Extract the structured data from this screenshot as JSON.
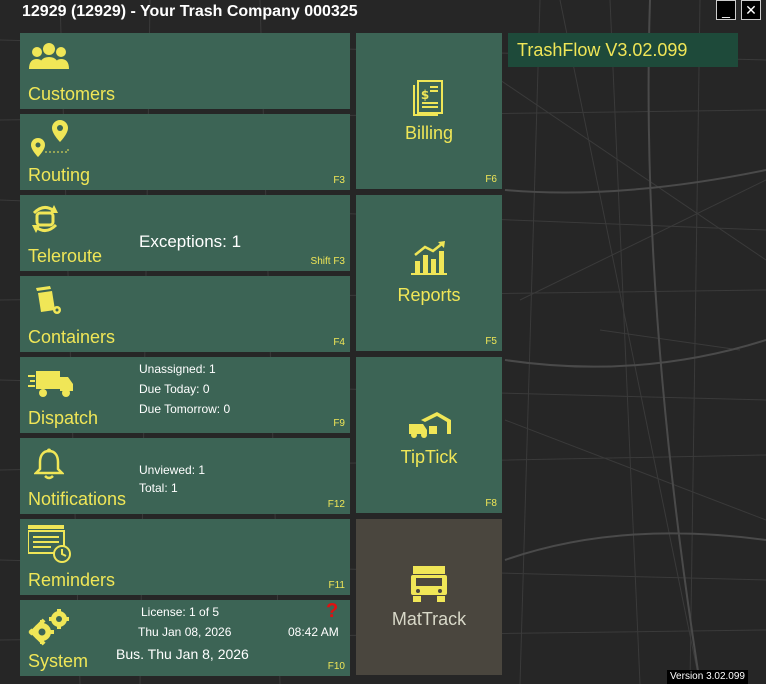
{
  "window": {
    "title": "12929 (12929) - Your Trash Company 000325",
    "minimize": "_",
    "close": "✕"
  },
  "app_version": "TrashFlow  V3.02.099",
  "footer_version": "Version 3.02.099",
  "colors": {
    "tile": "#3c6455",
    "tile_dark": "#4a463e",
    "accent": "#f0e657",
    "version_box": "#1e4a3a"
  },
  "tiles": {
    "customers": {
      "label": "Customers",
      "icon": "people-icon"
    },
    "routing": {
      "label": "Routing",
      "fkey": "F3",
      "icon": "map-pin-icon"
    },
    "teleroute": {
      "label": "Teleroute",
      "fkey": "Shift F3",
      "exceptions": "Exceptions: 1",
      "icon": "teleroute-icon"
    },
    "containers": {
      "label": "Containers",
      "fkey": "F4",
      "icon": "trash-can-icon"
    },
    "dispatch": {
      "label": "Dispatch",
      "fkey": "F9",
      "unassigned": "Unassigned: 1",
      "due_today": "Due Today: 0",
      "due_tomorrow": "Due Tomorrow: 0",
      "icon": "truck-icon"
    },
    "notifications": {
      "label": "Notifications",
      "fkey": "F12",
      "unviewed": "Unviewed: 1",
      "total": "Total: 1",
      "icon": "bell-icon"
    },
    "reminders": {
      "label": "Reminders",
      "fkey": "F11",
      "icon": "calendar-clock-icon"
    },
    "system": {
      "label": "System",
      "fkey": "F10",
      "license": "License: 1 of 5",
      "date": "Thu Jan 08, 2026",
      "time": "08:42 AM",
      "bus_date": "Bus. Thu Jan 8, 2026",
      "help": "?",
      "icon": "gears-icon"
    },
    "billing": {
      "label": "Billing",
      "fkey": "F6",
      "icon": "invoice-icon"
    },
    "reports": {
      "label": "Reports",
      "fkey": "F5",
      "icon": "bar-chart-icon"
    },
    "tiptick": {
      "label": "TipTick",
      "fkey": "F8",
      "icon": "dump-truck-icon"
    },
    "mattrack": {
      "label": "MatTrack",
      "icon": "mattrack-truck-icon"
    }
  }
}
